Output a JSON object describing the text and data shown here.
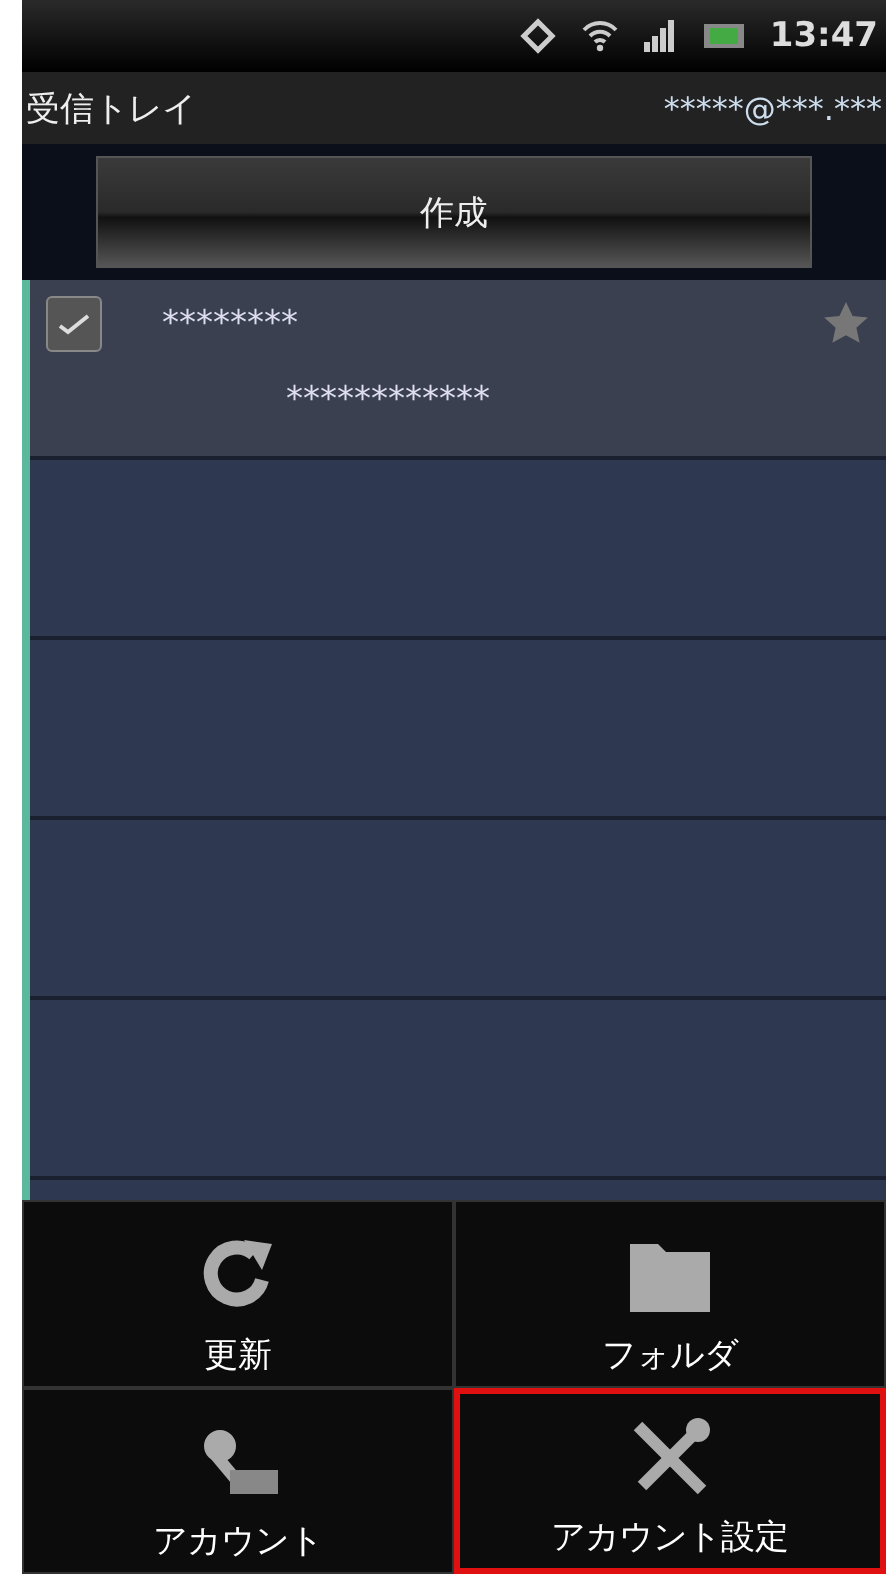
{
  "status_bar": {
    "time": "13:47"
  },
  "header": {
    "title": "受信トレイ",
    "account": "*****@***.***"
  },
  "compose_button": {
    "label": "作成"
  },
  "messages": [
    {
      "checked": true,
      "sender": "********",
      "subject": "************",
      "starred": false
    }
  ],
  "menu": [
    {
      "label": "更新",
      "kind": "refresh",
      "highlighted": false
    },
    {
      "label": "フォルダ",
      "kind": "folder",
      "highlighted": false
    },
    {
      "label": "アカウント",
      "kind": "account",
      "highlighted": false
    },
    {
      "label": "アカウント設定",
      "kind": "settings",
      "highlighted": true
    }
  ]
}
